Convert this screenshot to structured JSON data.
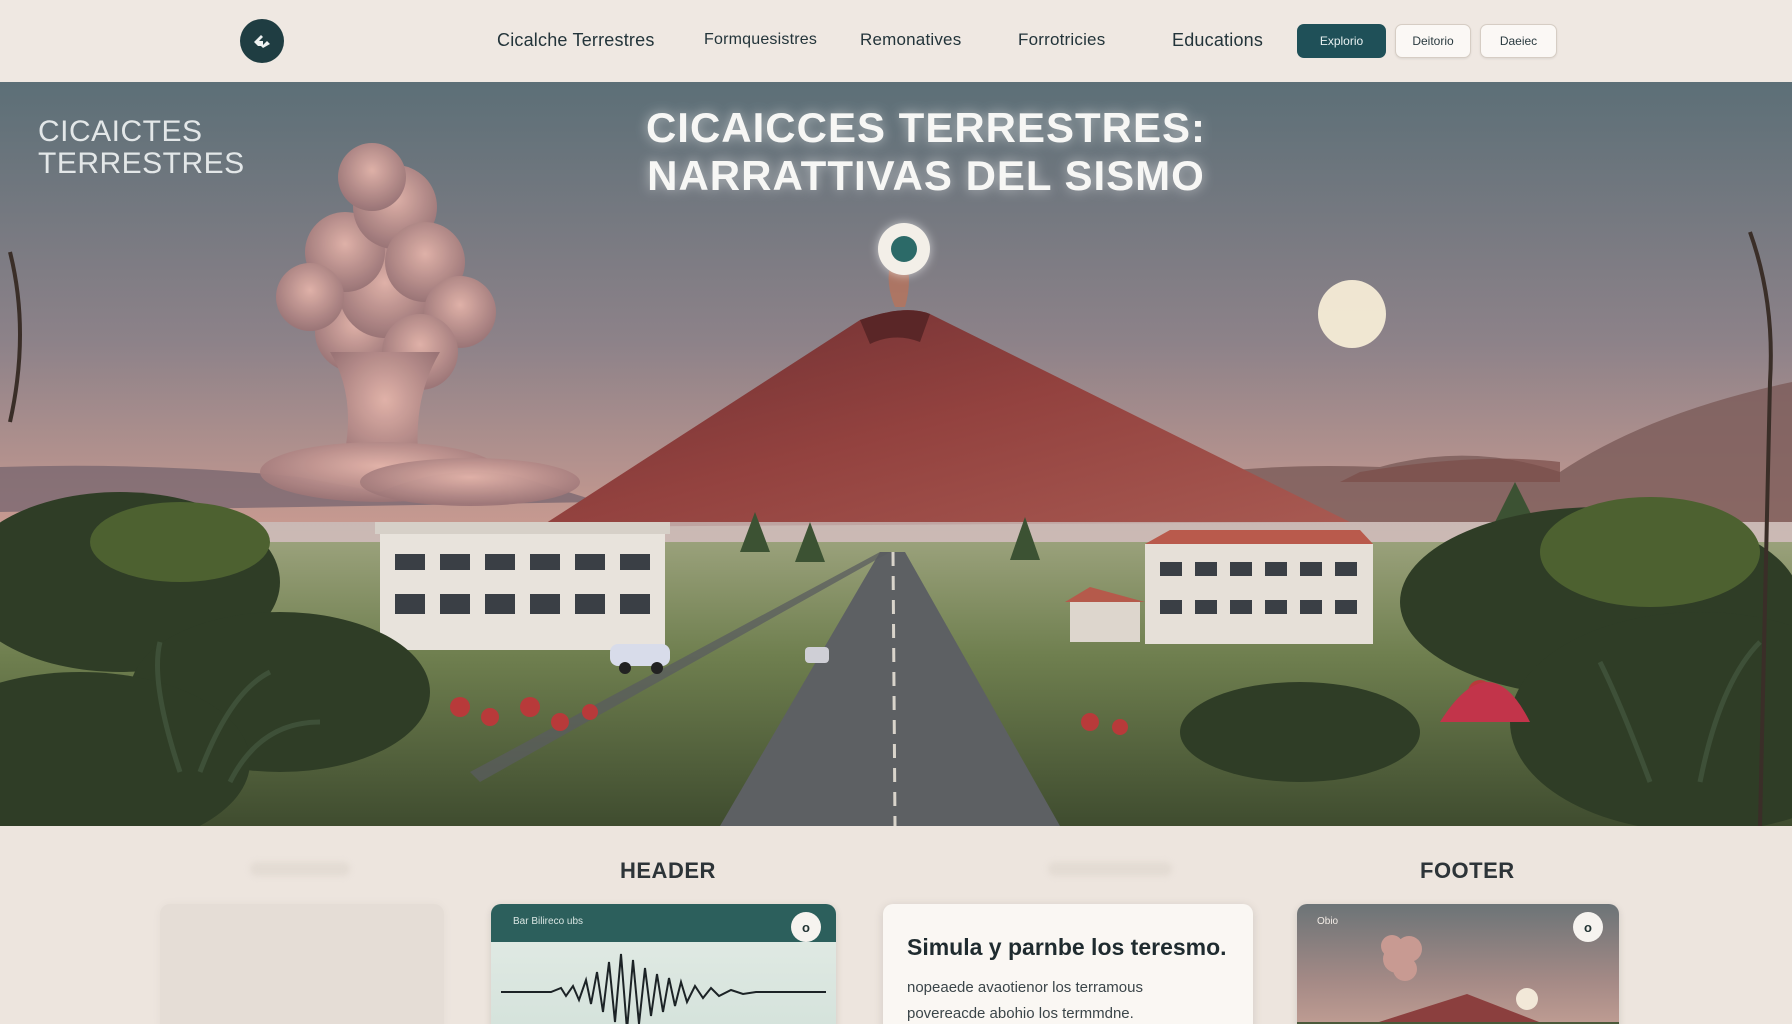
{
  "nav": {
    "links": [
      "Cicalche Terrestres",
      "Formquesistres",
      "Remonatives",
      "Forrotricies",
      "Educations"
    ],
    "buttons": {
      "primary": "Explorio",
      "secondary": "Deitorio",
      "tertiary": "Daeiec"
    },
    "logo_icon": "tool-icon"
  },
  "hero": {
    "corner_title_line1": "CICAICTES",
    "corner_title_line2": "TERRESTRES",
    "title_line1": "CICAICCES TERRESTRES:",
    "title_line2": "NARRATTIVAS DEL SISMO",
    "colors": {
      "sky_top": "#5d7078",
      "sky_mid": "#9a8790",
      "sky_low": "#d4a393",
      "volcano": "#8a3e3c",
      "plume": "#c89a92"
    }
  },
  "sections": {
    "header_label": "HEADER",
    "footer_label": "FOOTER"
  },
  "cards": {
    "wave": {
      "tag": "Bar Bilireco ubs",
      "button": "o"
    },
    "text": {
      "title": "Simula y parnbe los teresmo.",
      "line1": "nopeaede avaotienor los terramous",
      "line2": "povereacde abohio los termmdne."
    },
    "image": {
      "tag": "Obio",
      "button": "o"
    }
  }
}
